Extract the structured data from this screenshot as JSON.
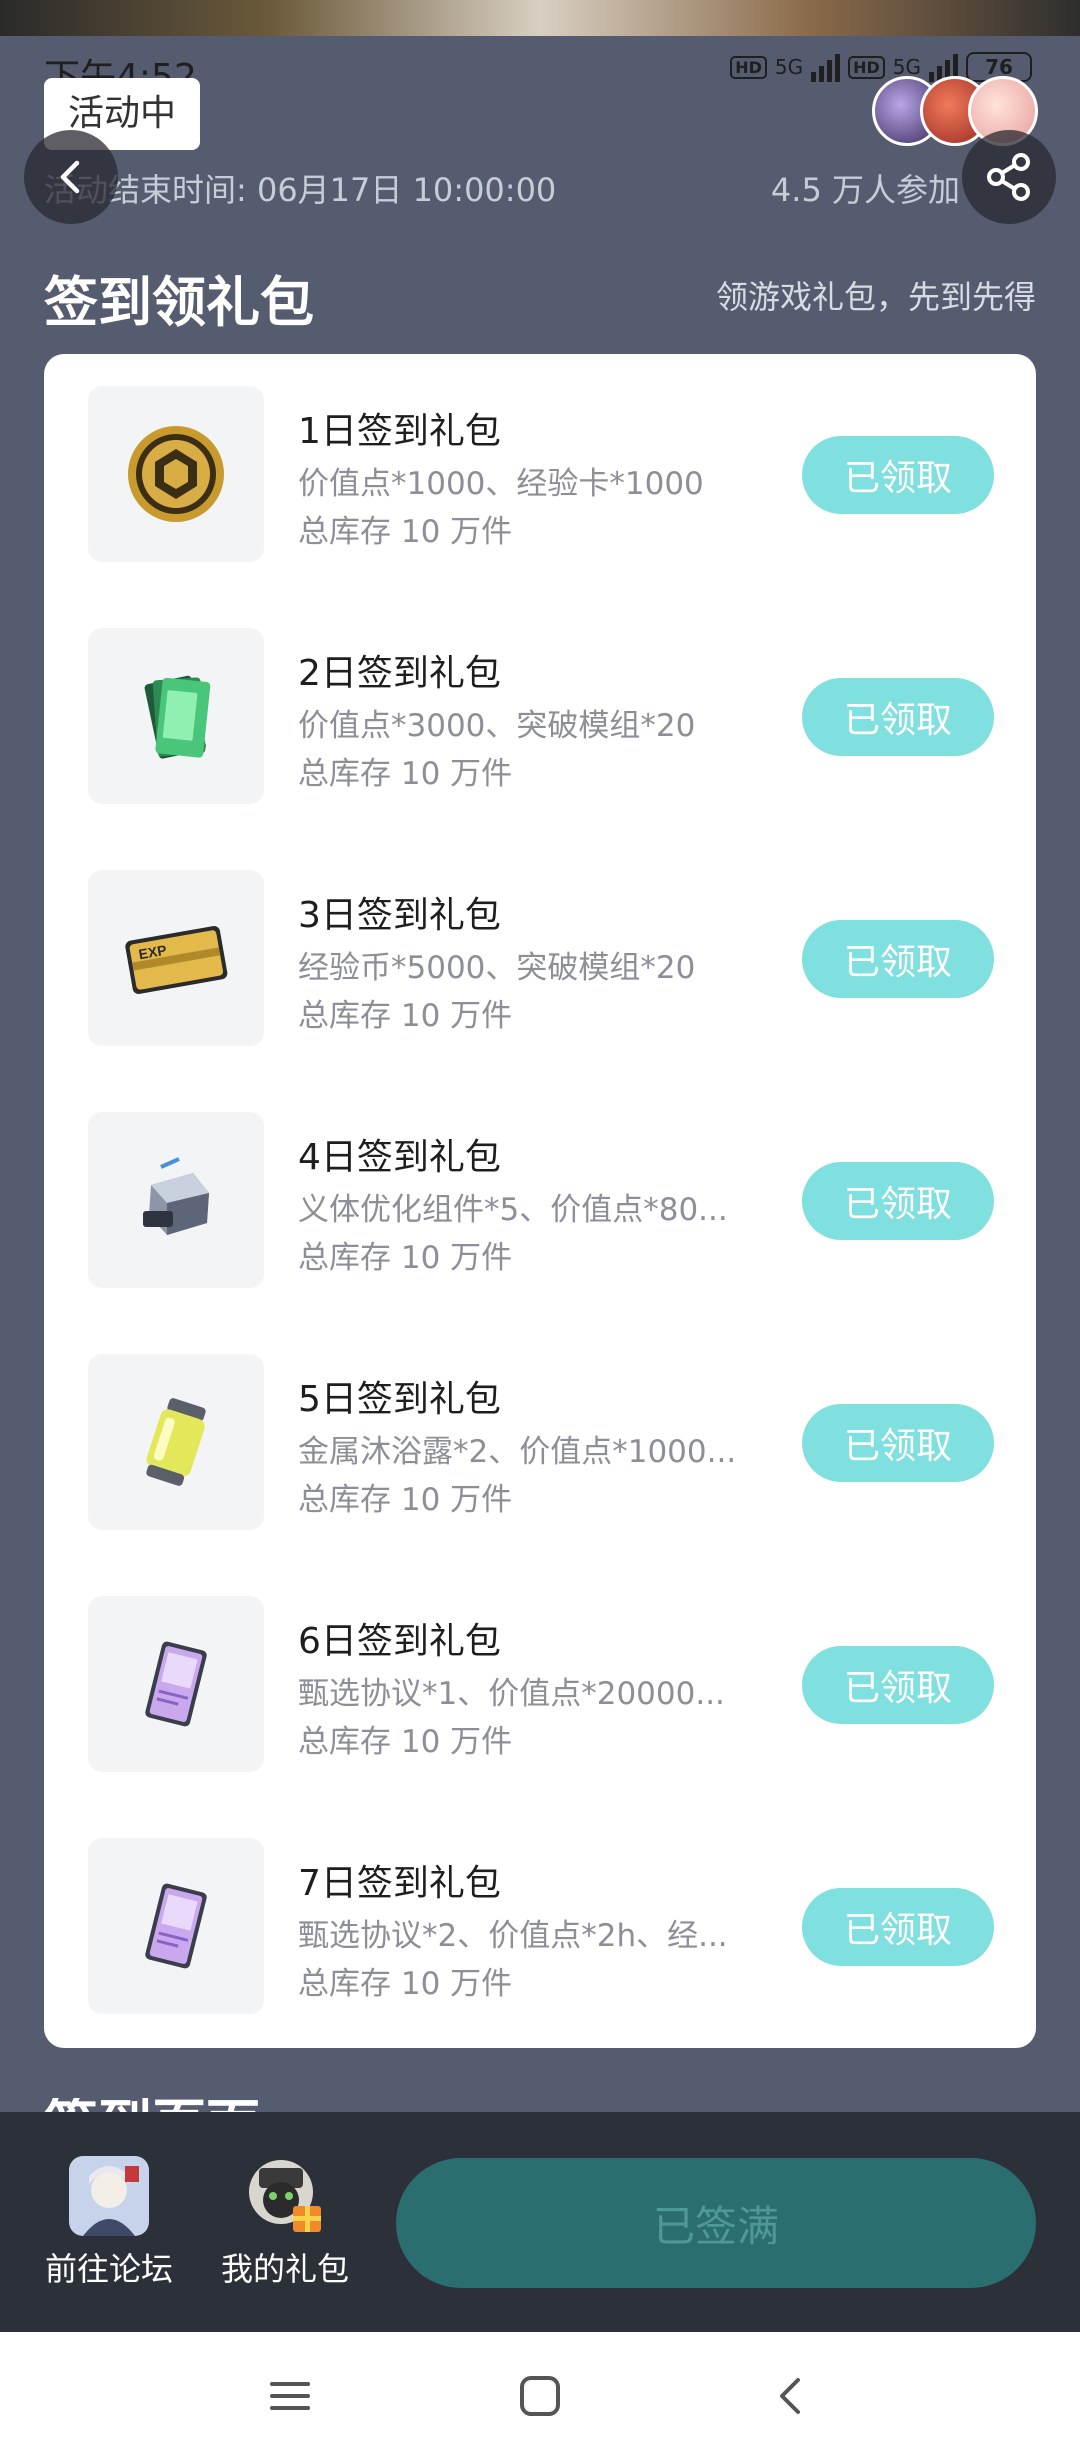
{
  "status_bar": {
    "time": "下午4:52",
    "hd1": "HD",
    "hd2": "HD",
    "net1": "5G",
    "net2": "5G",
    "battery": "76"
  },
  "header": {
    "badge": "活动中",
    "end_time": "活动结束时间: 06月17日 10:00:00",
    "participants": "4.5 万人参加"
  },
  "section": {
    "title": "签到领礼包",
    "subtitle": "领游戏礼包，先到先得"
  },
  "gifts": [
    {
      "title": "1日签到礼包",
      "desc": "价值点*1000、经验卡*1000",
      "stock": "总库存 10 万件",
      "button": "已领取",
      "icon": "gold-coin-icon"
    },
    {
      "title": "2日签到礼包",
      "desc": "价值点*3000、突破模组*20",
      "stock": "总库存 10 万件",
      "button": "已领取",
      "icon": "green-card-stack-icon"
    },
    {
      "title": "3日签到礼包",
      "desc": "经验币*5000、突破模组*20",
      "stock": "总库存 10 万件",
      "button": "已领取",
      "icon": "exp-card-icon"
    },
    {
      "title": "4日签到礼包",
      "desc": "义体优化组件*5、价值点*80...",
      "stock": "总库存 10 万件",
      "button": "已领取",
      "icon": "mech-component-icon"
    },
    {
      "title": "5日签到礼包",
      "desc": "金属沐浴露*2、价值点*1000...",
      "stock": "总库存 10 万件",
      "button": "已领取",
      "icon": "canister-icon"
    },
    {
      "title": "6日签到礼包",
      "desc": "甄选协议*1、价值点*20000...",
      "stock": "总库存 10 万件",
      "button": "已领取",
      "icon": "protocol-card-icon"
    },
    {
      "title": "7日签到礼包",
      "desc": "甄选协议*2、价值点*2h、经...",
      "stock": "总库存 10 万件",
      "button": "已领取",
      "icon": "protocol-card-icon"
    }
  ],
  "next_section_peek": "签到页面",
  "bottom_bar": {
    "forum_label": "前往论坛",
    "my_gifts_label": "我的礼包",
    "signed_label": "已签满"
  },
  "colors": {
    "page_bg": "#565c6f",
    "claim_button": "#7fe0df",
    "signed_button": "#2b6e6f",
    "bottom_bar": "#2c3039"
  }
}
